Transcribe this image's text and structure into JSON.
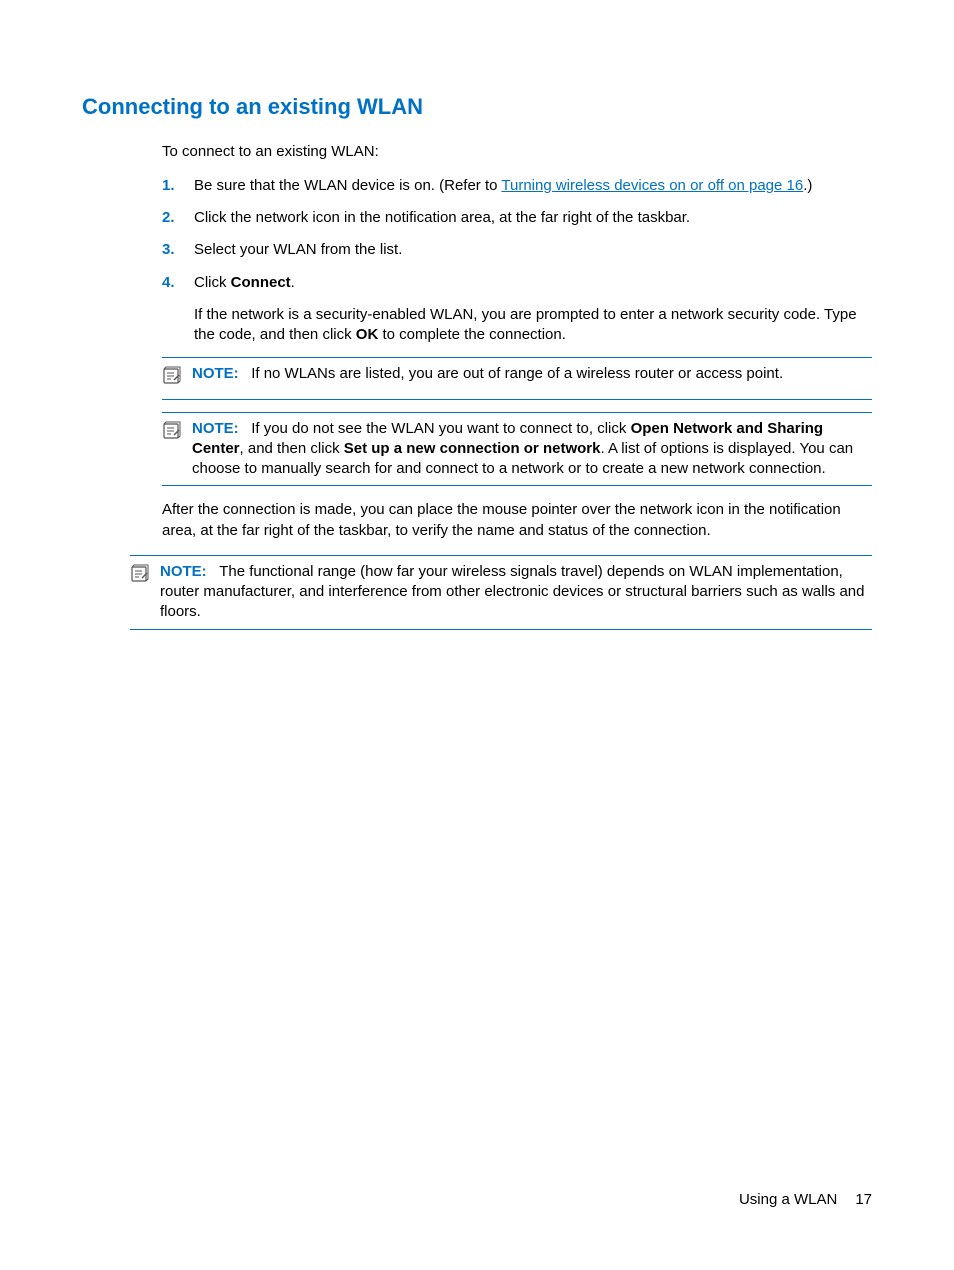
{
  "heading": "Connecting to an existing WLAN",
  "intro": "To connect to an existing WLAN:",
  "steps": [
    {
      "num": "1.",
      "pre": "Be sure that the WLAN device is on. (Refer to ",
      "link": "Turning wireless devices on or off on page 16",
      "post": ".)"
    },
    {
      "num": "2.",
      "text": "Click the network icon in the notification area, at the far right of the taskbar."
    },
    {
      "num": "3.",
      "text": "Select your WLAN from the list."
    },
    {
      "num": "4.",
      "pre": "Click ",
      "bold": "Connect",
      "post": ".",
      "para2_pre": "If the network is a security-enabled WLAN, you are prompted to enter a network security code. Type the code, and then click ",
      "para2_bold": "OK",
      "para2_post": " to complete the connection."
    }
  ],
  "note_label": "NOTE:",
  "note1": "If no WLANs are listed, you are out of range of a wireless router or access point.",
  "note2": {
    "pre": "If you do not see the WLAN you want to connect to, click ",
    "b1": "Open Network and Sharing Center",
    "mid": ", and then click ",
    "b2": "Set up a new connection or network",
    "post": ". A list of options is displayed. You can choose to manually search for and connect to a network or to create a new network connection."
  },
  "after": "After the connection is made, you can place the mouse pointer over the network icon in the notification area, at the far right of the taskbar, to verify the name and status of the connection.",
  "note3": "The functional range (how far your wireless signals travel) depends on WLAN implementation, router manufacturer, and interference from other electronic devices or structural barriers such as walls and floors.",
  "footer_section": "Using a WLAN",
  "footer_page": "17"
}
